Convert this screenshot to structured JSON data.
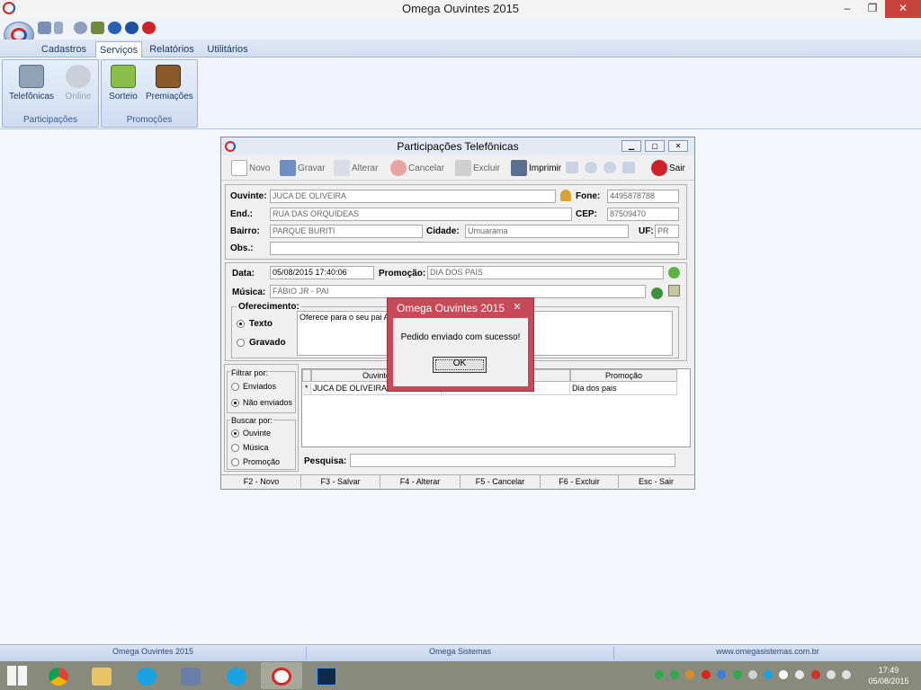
{
  "app": {
    "title": "Omega Ouvintes 2015"
  },
  "window_controls": {
    "minimize": "–",
    "restore": "❐",
    "close": "✕"
  },
  "ribbon": {
    "tabs": [
      "Cadastros",
      "Serviços",
      "Relatórios",
      "Utilitários"
    ],
    "active_tab": "Serviços",
    "groups": [
      {
        "label": "Participações",
        "buttons": [
          {
            "label": "Telefônicas",
            "enabled": true
          },
          {
            "label": "Online",
            "enabled": false
          }
        ]
      },
      {
        "label": "Promoções",
        "buttons": [
          {
            "label": "Sorteio",
            "enabled": true
          },
          {
            "label": "Premiações",
            "enabled": true
          }
        ]
      }
    ]
  },
  "child": {
    "title": "Participações Telefônicas",
    "toolbar": {
      "novo": "Novo",
      "gravar": "Gravar",
      "alterar": "Alterar",
      "cancelar": "Cancelar",
      "excluir": "Excluir",
      "imprimir": "Imprimir",
      "sair": "Sair"
    },
    "form": {
      "ouvinte_label": "Ouvinte:",
      "ouvinte": "JUCA DE OLIVEIRA",
      "fone_label": "Fone:",
      "fone": "4495878788",
      "end_label": "End.:",
      "end": "RUA DAS ORQUÍDEAS",
      "cep_label": "CEP:",
      "cep": "87509470",
      "bairro_label": "Bairro:",
      "bairro": "PARQUE BURITI",
      "cidade_label": "Cidade:",
      "cidade": "Umuarama",
      "uf_label": "UF:",
      "uf": "PR",
      "obs_label": "Obs.:",
      "obs": "",
      "data_label": "Data:",
      "data": "05/08/2015 17:40:06",
      "promocao_label": "Promoção:",
      "promocao": "DIA DOS PAIS",
      "musica_label": "Música:",
      "musica": "FÁBIO JR - PAI",
      "oferecimento_label": "Oferecimento:",
      "texto_label": "Texto",
      "gravado_label": "Gravado",
      "oferecimento_text": "Oferece para o seu pai Ap"
    },
    "filtrar": {
      "label": "Filtrar por:",
      "enviados": "Enviados",
      "nao_enviados": "Não enviados",
      "selected": "Não enviados"
    },
    "buscar": {
      "label": "Buscar por:",
      "ouvinte": "Ouvinte",
      "musica": "Música",
      "promocao": "Promoção",
      "selected": "Ouvinte"
    },
    "grid": {
      "columns": [
        "Ouvinte",
        "",
        "Promoção"
      ],
      "rows": [
        {
          "marker": "*",
          "ouvinte": "JUCA DE OLIVEIRA",
          "musica": "",
          "promocao": "Dia dos pais"
        }
      ]
    },
    "pesquisa_label": "Pesquisa:",
    "shortcuts": [
      "F2 - Novo",
      "F3 - Salvar",
      "F4 - Alterar",
      "F5 - Cancelar",
      "F6 - Excluir",
      "Esc - Sair"
    ]
  },
  "dialog": {
    "title": "Omega Ouvintes 2015",
    "message": "Pedido enviado com sucesso!",
    "ok": "OK"
  },
  "statusbar": [
    "Omega Ouvintes 2015",
    "Omega Sistemas",
    "www.omegasistemas.com.br"
  ],
  "clock": {
    "time": "17:49",
    "date": "05/08/2015"
  }
}
